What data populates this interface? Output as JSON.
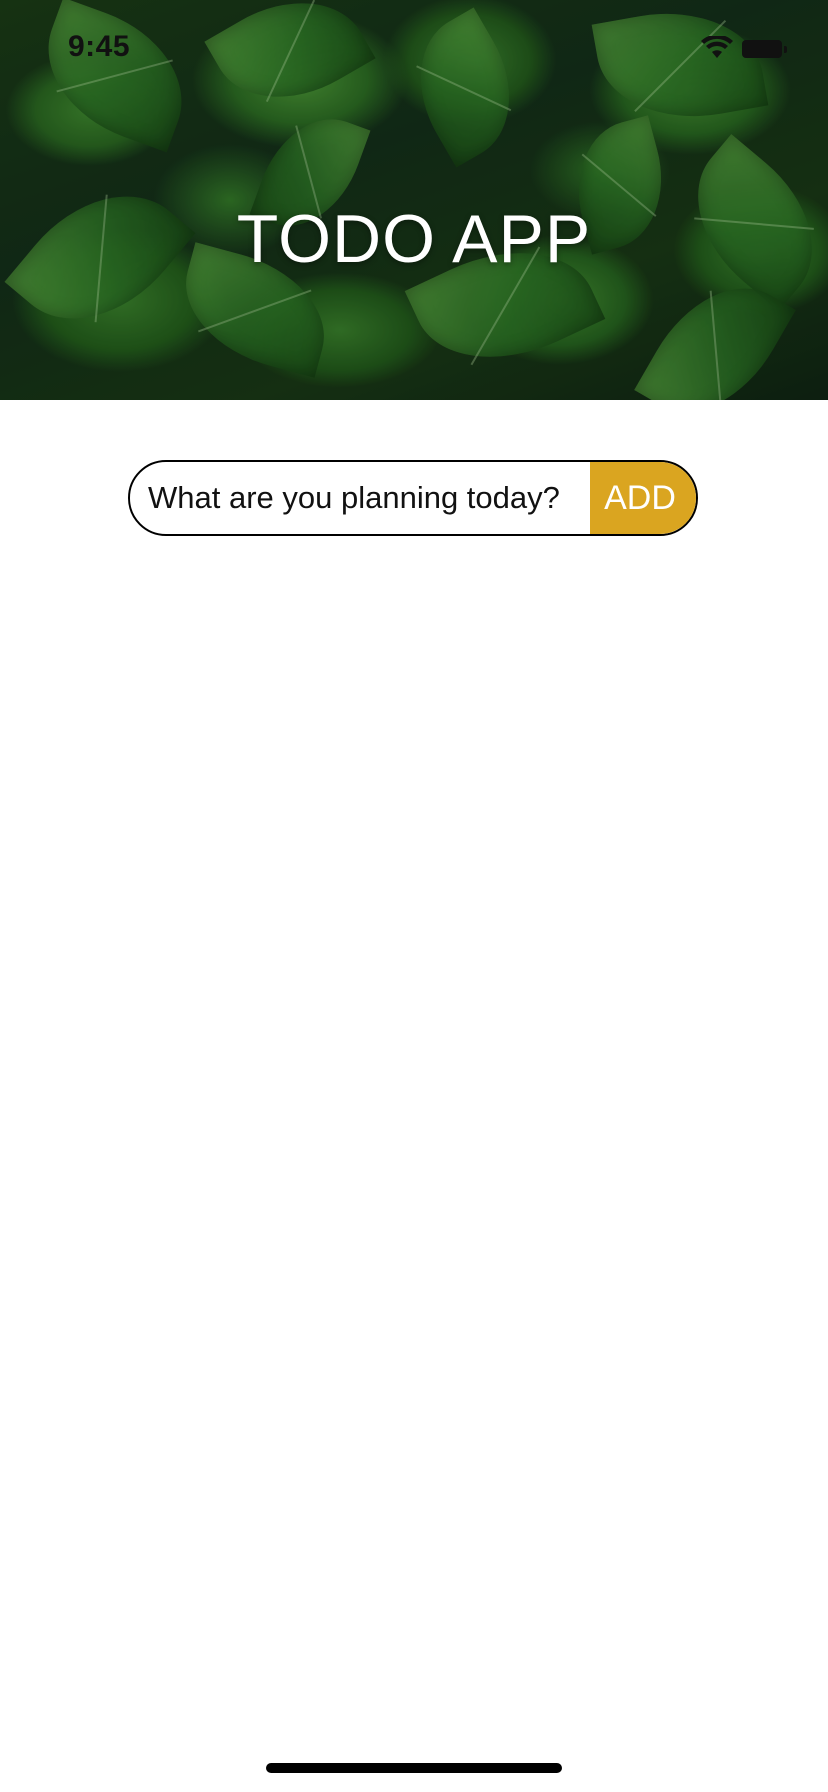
{
  "status_bar": {
    "time": "9:45",
    "wifi_icon": "wifi-icon",
    "battery_icon": "battery-icon"
  },
  "header": {
    "title": "TODO APP",
    "background": "green leaves photo"
  },
  "todo_form": {
    "input_placeholder": "What are you planning today?",
    "input_value": "",
    "add_label": "ADD"
  },
  "todos": [],
  "colors": {
    "accent": "#daa520",
    "title_text": "#ffffff",
    "input_border": "#000000"
  }
}
